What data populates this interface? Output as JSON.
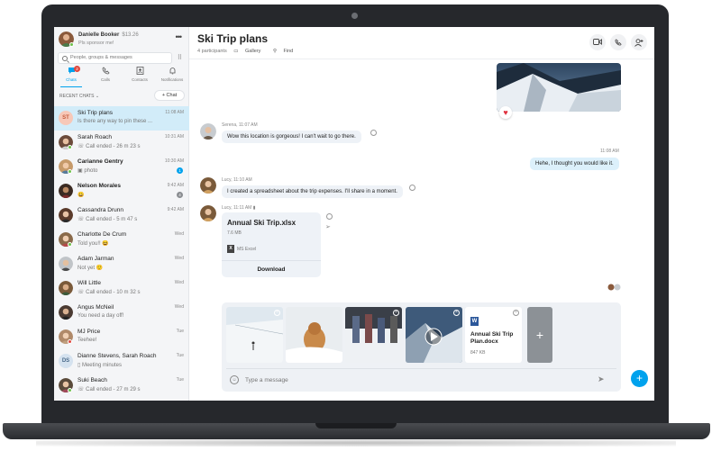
{
  "profile": {
    "name": "Danielle Booker",
    "credit": "$13.26",
    "mood": "Pls sponsor me!"
  },
  "search": {
    "placeholder": "People, groups & messages"
  },
  "nav": {
    "items": [
      {
        "label": "Chats",
        "icon": "chat-icon",
        "badge": "2",
        "active": true
      },
      {
        "label": "Calls",
        "icon": "phone-icon"
      },
      {
        "label": "Contacts",
        "icon": "contacts-icon"
      },
      {
        "label": "Notifications",
        "icon": "bell-icon"
      }
    ]
  },
  "recent": {
    "label": "RECENT CHATS",
    "new_chat": "+ Chat"
  },
  "chats": [
    {
      "name": "Ski Trip plans",
      "sub": "Is there any way to pin these ...",
      "time": "11:08 AM",
      "initials": "ST",
      "active": true
    },
    {
      "name": "Sarah Roach",
      "sub": "Call ended - 26 m 23 s",
      "time": "10:31 AM"
    },
    {
      "name": "Carianne Gentry",
      "sub": "photo",
      "time": "10:30 AM",
      "badge": "1"
    },
    {
      "name": "Nelson Morales",
      "sub": "",
      "time": "9:42 AM",
      "badge": "4"
    },
    {
      "name": "Cassandra Drunn",
      "sub": "Call ended - 5 m 47 s",
      "time": "9:42 AM"
    },
    {
      "name": "Charlotte De Crum",
      "sub": "Told you!!",
      "time": "Wed"
    },
    {
      "name": "Adam Jarman",
      "sub": "Not yet",
      "time": "Wed"
    },
    {
      "name": "Will Little",
      "sub": "Call ended - 10 m 32 s",
      "time": "Wed"
    },
    {
      "name": "Angus McNeil",
      "sub": "You need a day off!",
      "time": "Wed"
    },
    {
      "name": "MJ Price",
      "sub": "Teehee!",
      "time": "Tue"
    },
    {
      "name": "Dianne Stevens, Sarah Roach",
      "sub": "Meeting minutes",
      "time": "Tue",
      "initials": "DS"
    },
    {
      "name": "Suki Beach",
      "sub": "Call ended - 27 m 29 s",
      "time": "Tue"
    }
  ],
  "conversation": {
    "title": "Ski Trip plans",
    "participants": "4 participants",
    "gallery": "Gallery",
    "find": "Find",
    "messages": [
      {
        "meta": "Serena, 11:07 AM",
        "text": "Wow this location is gorgeous! I can't wait to go there."
      },
      {
        "meta": "11:08 AM",
        "text": "Hehe, I thought you would like it."
      },
      {
        "meta": "Lucy, 11:10 AM",
        "text": "I created a spreadsheet about the trip expenses. I'll share in a moment."
      },
      {
        "meta": "Lucy, 11:11 AM"
      }
    ],
    "file": {
      "name": "Annual Ski Trip.xlsx",
      "size": "7.6 MB",
      "app": "MS Excel",
      "download": "Download"
    }
  },
  "composer": {
    "doc": {
      "name": "Annual Ski Trip Plan.docx",
      "size": "847 KB"
    },
    "placeholder": "Type a message"
  },
  "colors": {
    "accent": "#00a2ed",
    "active_chat": "#d2ecf9",
    "heart": "#e0313e",
    "online": "#6cc04a"
  }
}
